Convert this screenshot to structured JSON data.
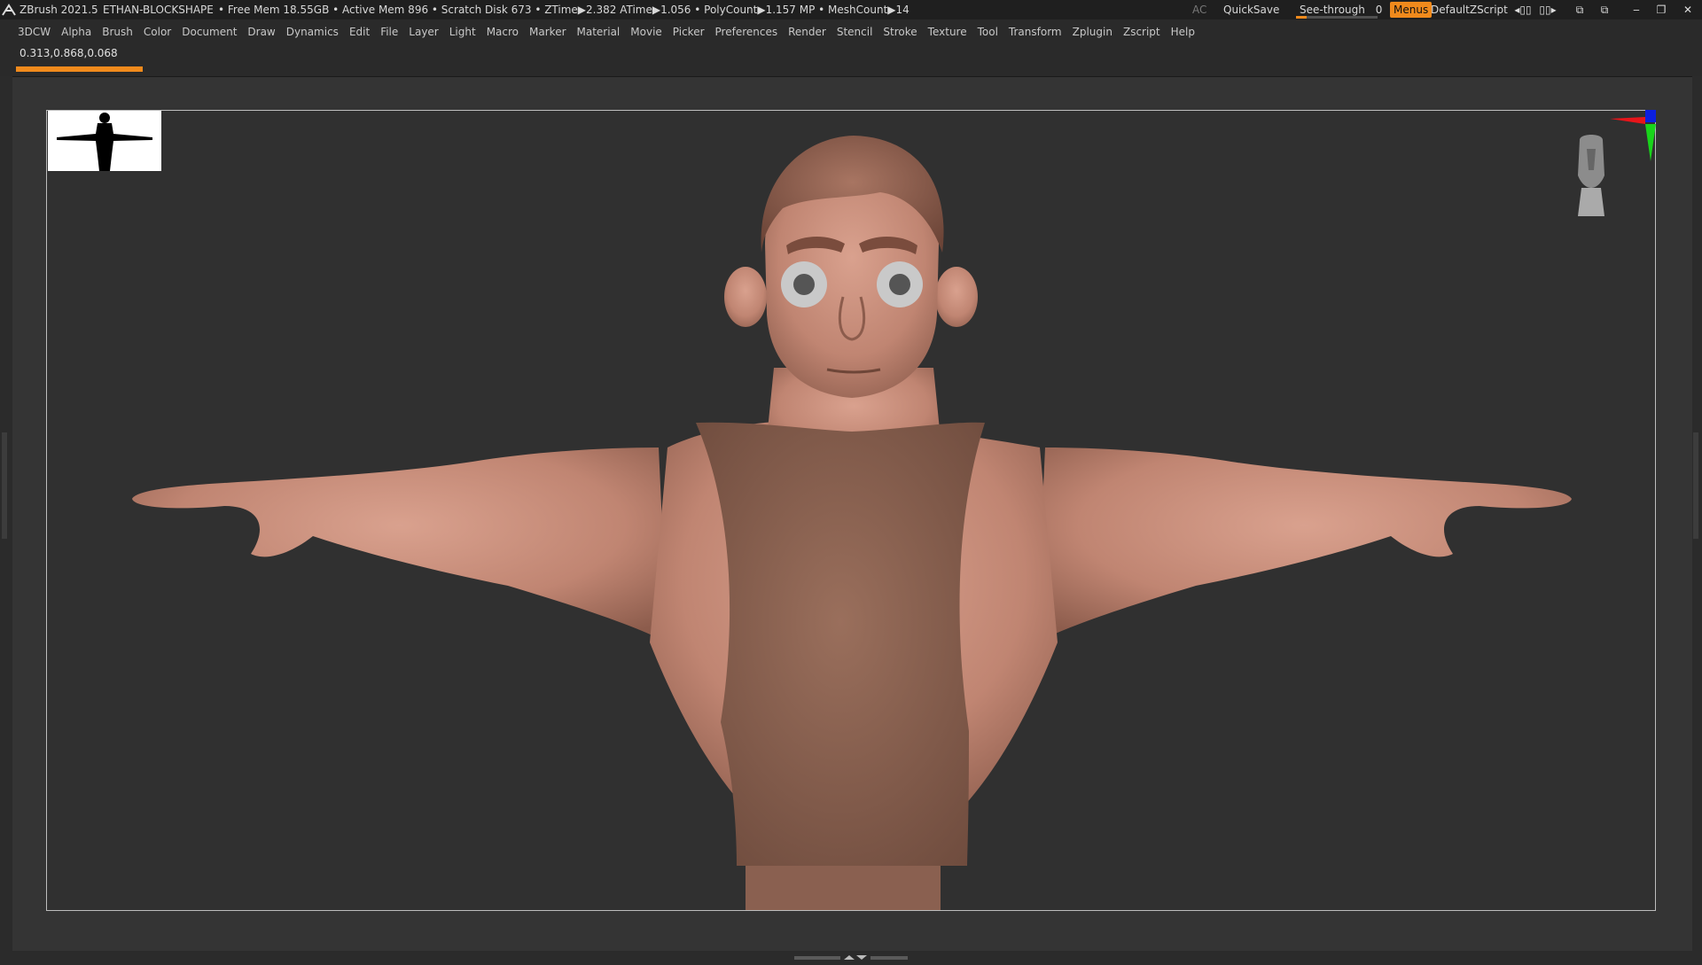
{
  "titlebar": {
    "app": "ZBrush 2021.5",
    "document": "ETHAN-BLOCKSHAPE",
    "stats": "• Free Mem 18.55GB • Active Mem 896 • Scratch Disk 673 • ZTime▶2.382 ATime▶1.056 • PolyCount▶1.157 MP • MeshCount▶14",
    "ac": "AC",
    "quicksave": "QuickSave",
    "see_through_label": "See-through",
    "see_through_value": "0",
    "see_through_level": 0,
    "menus": "Menus",
    "script": "DefaultZScript"
  },
  "menubar": {
    "items": [
      "3DCW",
      "Alpha",
      "Brush",
      "Color",
      "Document",
      "Draw",
      "Dynamics",
      "Edit",
      "File",
      "Layer",
      "Light",
      "Macro",
      "Marker",
      "Material",
      "Movie",
      "Picker",
      "Preferences",
      "Render",
      "Stencil",
      "Stroke",
      "Texture",
      "Tool",
      "Transform",
      "Zplugin",
      "Zscript",
      "Help"
    ]
  },
  "infobar": {
    "color_readout": "0.313,0.868,0.068",
    "progress_fraction": 1.0
  },
  "colors": {
    "accent": "#f08a1c",
    "skin": "#c48a78",
    "shirt": "#8a6250",
    "background": "#303030"
  },
  "icons": {
    "logo": "zbrush-logo-icon",
    "nav_cube": "head-navigation-icon",
    "axis": "axis-gizmo-icon"
  }
}
